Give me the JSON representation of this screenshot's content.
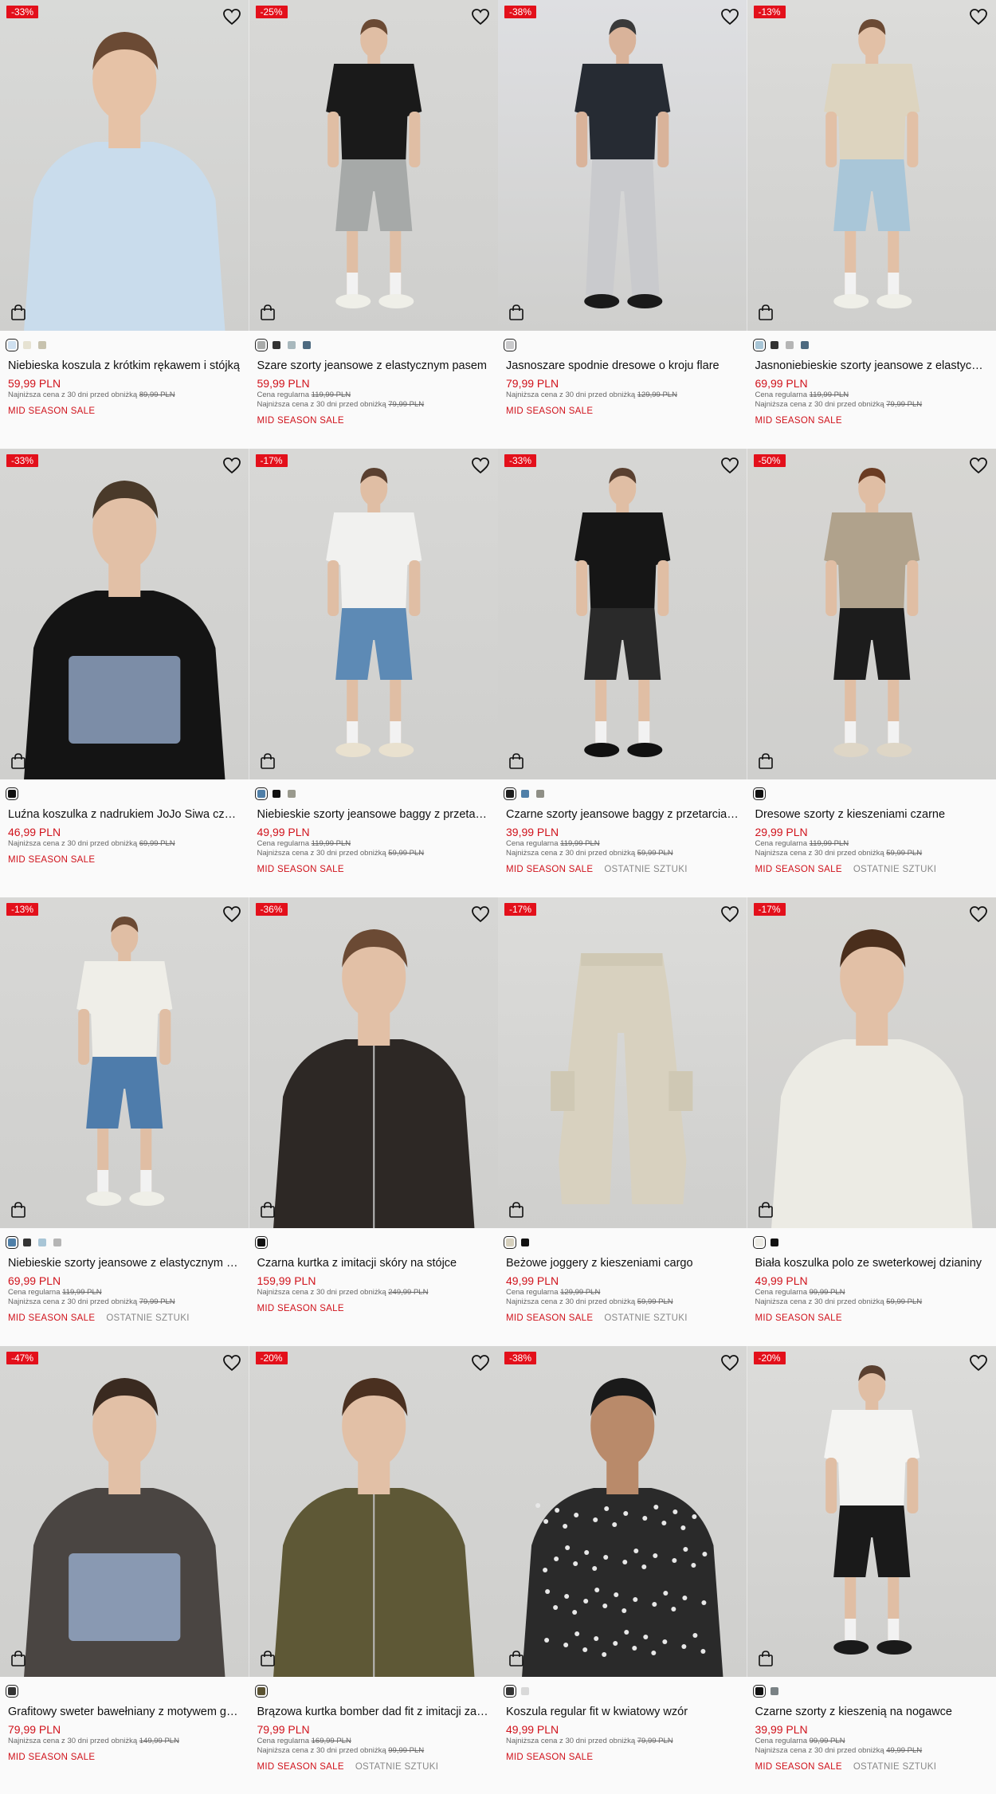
{
  "labels": {
    "regular_price": "Cena regularna",
    "lowest_price": "Najniższa cena z 30 dni przed obniżką"
  },
  "icons": {
    "favorite": "heart-outline-icon",
    "quick_add": "shopping-bag-icon"
  },
  "products": [
    {
      "discount": "-33%",
      "name": "Niebieska koszula z krótkim rękawem i stójką",
      "price": "59,99 PLN",
      "regular": "",
      "lowest": "89,99 PLN",
      "tags": [
        "MID SEASON SALE"
      ],
      "swatches": [
        "#cfe0f0",
        "#e6e2d2",
        "#c7c2ae"
      ]
    },
    {
      "discount": "-25%",
      "name": "Szare szorty jeansowe z elastycznym pasem",
      "price": "59,99 PLN",
      "regular": "119,99 PLN",
      "lowest": "79,99 PLN",
      "tags": [
        "MID SEASON SALE"
      ],
      "swatches": [
        "#a9abaa",
        "#333333",
        "#a8b8bd",
        "#4d6a80"
      ]
    },
    {
      "discount": "-38%",
      "name": "Jasnoszare spodnie dresowe o kroju flare",
      "price": "79,99 PLN",
      "regular": "",
      "lowest": "129,99 PLN",
      "tags": [
        "MID SEASON SALE"
      ],
      "swatches": [
        "#c9c9cb"
      ]
    },
    {
      "discount": "-13%",
      "name": "Jasnoniebieskie szorty jeansowe z elastycznym pasem",
      "price": "69,99 PLN",
      "regular": "119,99 PLN",
      "lowest": "79,99 PLN",
      "tags": [
        "MID SEASON SALE"
      ],
      "swatches": [
        "#a8c5d6",
        "#333333",
        "#b5b5b5",
        "#4d6a80"
      ]
    },
    {
      "discount": "-33%",
      "name": "Luźna koszulka z nadrukiem JoJo Siwa czarna",
      "price": "46,99 PLN",
      "regular": "",
      "lowest": "69,99 PLN",
      "tags": [
        "MID SEASON SALE"
      ],
      "swatches": [
        "#111111"
      ]
    },
    {
      "discount": "-17%",
      "name": "Niebieskie szorty jeansowe baggy z przetarciami",
      "price": "49,99 PLN",
      "regular": "119,99 PLN",
      "lowest": "59,99 PLN",
      "tags": [
        "MID SEASON SALE"
      ],
      "swatches": [
        "#4f7fa8",
        "#111111",
        "#9a9a8e"
      ]
    },
    {
      "discount": "-33%",
      "name": "Czarne szorty jeansowe baggy z przetarciami",
      "price": "39,99 PLN",
      "regular": "119,99 PLN",
      "lowest": "59,99 PLN",
      "tags": [
        "MID SEASON SALE",
        "OSTATNIE SZTUKI"
      ],
      "swatches": [
        "#1e1e1e",
        "#4f7fa8",
        "#8f8f86"
      ]
    },
    {
      "discount": "-50%",
      "name": "Dresowe szorty z kieszeniami czarne",
      "price": "29,99 PLN",
      "regular": "119,99 PLN",
      "lowest": "59,99 PLN",
      "tags": [
        "MID SEASON SALE",
        "OSTATNIE SZTUKI"
      ],
      "swatches": [
        "#111111"
      ]
    },
    {
      "discount": "-13%",
      "name": "Niebieskie szorty jeansowe z elastycznym pasem",
      "price": "69,99 PLN",
      "regular": "119,99 PLN",
      "lowest": "79,99 PLN",
      "tags": [
        "MID SEASON SALE",
        "OSTATNIE SZTUKI"
      ],
      "swatches": [
        "#4f7fa8",
        "#333333",
        "#a8c5d6",
        "#b5b5b5"
      ]
    },
    {
      "discount": "-36%",
      "name": "Czarna kurtka z imitacji skóry na stójce",
      "price": "159,99 PLN",
      "regular": "",
      "lowest": "249,99 PLN",
      "tags": [
        "MID SEASON SALE"
      ],
      "swatches": [
        "#111111"
      ]
    },
    {
      "discount": "-17%",
      "name": "Beżowe joggery z kieszeniami cargo",
      "price": "49,99 PLN",
      "regular": "129,99 PLN",
      "lowest": "59,99 PLN",
      "tags": [
        "MID SEASON SALE",
        "OSTATNIE SZTUKI"
      ],
      "swatches": [
        "#d6d0bd",
        "#111111"
      ]
    },
    {
      "discount": "-17%",
      "name": "Biała koszulka polo ze sweterkowej dzianiny",
      "price": "49,99 PLN",
      "regular": "99,99 PLN",
      "lowest": "59,99 PLN",
      "tags": [
        "MID SEASON SALE"
      ],
      "swatches": [
        "#ecebe4",
        "#111111"
      ]
    },
    {
      "discount": "-47%",
      "name": "Grafitowy sweter bawełniany z motywem graficznym",
      "price": "79,99 PLN",
      "regular": "",
      "lowest": "149,99 PLN",
      "tags": [
        "MID SEASON SALE"
      ],
      "swatches": [
        "#333333"
      ]
    },
    {
      "discount": "-20%",
      "name": "Brązowa kurtka bomber dad fit z imitacji zamszu",
      "price": "79,99 PLN",
      "regular": "169,99 PLN",
      "lowest": "99,99 PLN",
      "tags": [
        "MID SEASON SALE",
        "OSTATNIE SZTUKI"
      ],
      "swatches": [
        "#5b5332"
      ]
    },
    {
      "discount": "-38%",
      "name": "Koszula regular fit w kwiatowy wzór",
      "price": "49,99 PLN",
      "regular": "",
      "lowest": "79,99 PLN",
      "tags": [
        "MID SEASON SALE"
      ],
      "swatches": [
        "#333333",
        "#d9d9d9"
      ]
    },
    {
      "discount": "-20%",
      "name": "Czarne szorty z kieszenią na nogawce",
      "price": "39,99 PLN",
      "regular": "99,99 PLN",
      "lowest": "49,99 PLN",
      "tags": [
        "MID SEASON SALE",
        "OSTATNIE SZTUKI"
      ],
      "swatches": [
        "#111111",
        "#7a8285"
      ]
    }
  ]
}
